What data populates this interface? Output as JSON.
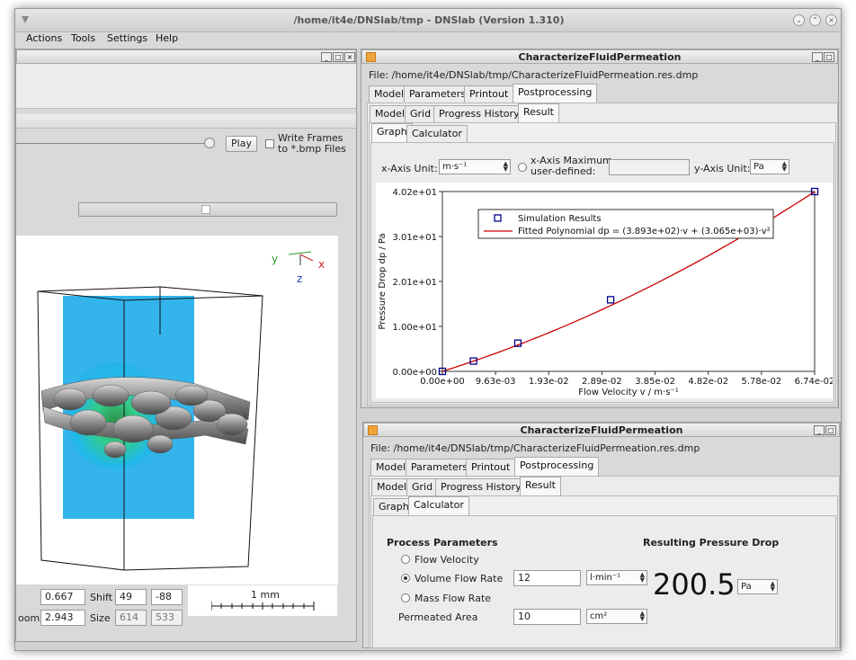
{
  "window": {
    "title": "/home/it4e/DNSlab/tmp - DNSlab (Version 1.310)"
  },
  "menubar": [
    "Actions",
    "Tools",
    "Settings",
    "Help"
  ],
  "viewer": {
    "play_label": "Play",
    "write_frames_label": "Write Frames",
    "write_frames_label2": "to *.bmp Files",
    "axes": {
      "y": "y",
      "x": "x",
      "z": "z"
    },
    "field1_value": "0.667",
    "shift_label": "Shift",
    "shift_x": "49",
    "shift_y": "-88",
    "zoom_label": "oom",
    "zoom_value": "2.943",
    "size_label": "Size",
    "size_w": "614",
    "size_h": "533",
    "scale_label": "1 mm"
  },
  "graph_window": {
    "title": "CharacterizeFluidPermeation",
    "file": "File: /home/it4e/DNSlab/tmp/CharacterizeFluidPermeation.res.dmp",
    "tabs1": [
      "Model",
      "Parameters",
      "Printout",
      "Postprocessing"
    ],
    "tabs2": [
      "Model",
      "Grid",
      "Progress History",
      "Result"
    ],
    "tabs3": [
      "Graph",
      "Calculator"
    ],
    "x_unit_label": "x-Axis Unit:",
    "x_unit_value": "m·s⁻¹",
    "x_max_label": "x-Axis Maximum",
    "x_max_label2": "user-defined:",
    "y_unit_label": "y-Axis Unit:",
    "y_unit_value": "Pa"
  },
  "chart_data": {
    "type": "scatter",
    "xlabel": "Flow Velocity v / m·s⁻¹",
    "ylabel": "Pressure Drop dp / Pa",
    "xlim": [
      0,
      0.0674
    ],
    "ylim": [
      0,
      40.2
    ],
    "x_ticks": [
      "0.00e+00",
      "9.63e-03",
      "1.93e-02",
      "2.89e-02",
      "3.85e-02",
      "4.82e-02",
      "5.78e-02",
      "6.74e-02"
    ],
    "y_ticks": [
      "0.00e+00",
      "1.00e+01",
      "2.01e+01",
      "3.01e+01",
      "4.02e+01"
    ],
    "series": [
      {
        "name": "Simulation Results",
        "type": "scatter",
        "color": "#00008b",
        "x": [
          0,
          0.00563,
          0.01367,
          0.03046,
          0.06741
        ],
        "y": [
          0,
          2.3,
          6.3,
          16.0,
          40.2
        ]
      },
      {
        "name": "Fitted Polynomial dp = (3.893e+02)·v + (3.065e+03)·v²",
        "type": "line",
        "color": "#cc0000",
        "coef": [
          389.3,
          3065
        ]
      }
    ],
    "legend": "top-left"
  },
  "calc_window": {
    "title": "CharacterizeFluidPermeation",
    "file": "File: /home/it4e/DNSlab/tmp/CharacterizeFluidPermeation.res.dmp",
    "tabs1": [
      "Model",
      "Parameters",
      "Printout",
      "Postprocessing"
    ],
    "tabs2": [
      "Model",
      "Grid",
      "Progress History",
      "Result"
    ],
    "tabs3": [
      "Graph",
      "Calculator"
    ],
    "process_title": "Process Parameters",
    "flow_velocity": "Flow Velocity",
    "volume_flow_rate": "Volume Flow Rate",
    "volume_flow_value": "12",
    "volume_flow_unit": "l·min⁻¹",
    "mass_flow_rate": "Mass Flow Rate",
    "permeated_area": "Permeated Area",
    "area_value": "10",
    "area_unit": "cm²",
    "result_title": "Resulting Pressure Drop",
    "result_value": "200.5",
    "result_unit": "Pa"
  }
}
